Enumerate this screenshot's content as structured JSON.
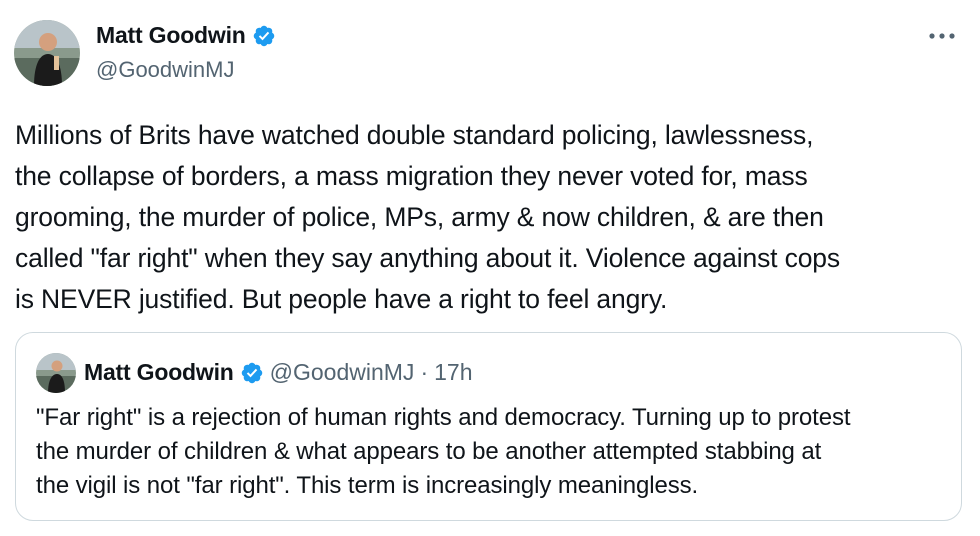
{
  "author": {
    "display_name": "Matt Goodwin",
    "handle": "@GoodwinMJ",
    "verified": true
  },
  "tweet": {
    "text": "Millions of Brits have watched double standard policing, lawlessness,\nthe collapse of borders, a mass migration they never voted for, mass\ngrooming, the murder of police, MPs, army & now children, & are then\ncalled \"far right\" when they say anything about it. Violence against cops\nis NEVER justified. But people have a right to feel angry."
  },
  "quoted_tweet": {
    "display_name": "Matt Goodwin",
    "handle": "@GoodwinMJ",
    "separator": "·",
    "time": "17h",
    "text": "\"Far right\" is a rejection of human rights and democracy. Turning up to protest\nthe murder of children & what appears to be another attempted stabbing at\nthe vigil is not \"far right\". This term is increasingly meaningless."
  },
  "colors": {
    "text_primary": "#0f1419",
    "text_secondary": "#536471",
    "verified_blue": "#1d9bf0",
    "border": "#cfd9de"
  },
  "icons": {
    "verified": "verified-badge-icon",
    "more": "more-horizontal-icon"
  }
}
